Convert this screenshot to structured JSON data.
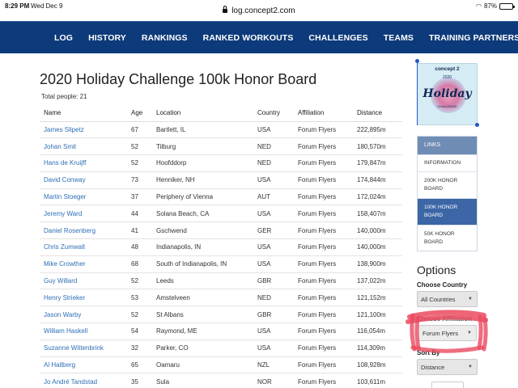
{
  "status_bar": {
    "time": "8:29 PM",
    "date": "Wed Dec 9",
    "battery": "87%",
    "battery_level": 0.87
  },
  "browser": {
    "url": "log.concept2.com"
  },
  "nav": [
    "LOG",
    "HISTORY",
    "RANKINGS",
    "RANKED WORKOUTS",
    "CHALLENGES",
    "TEAMS",
    "TRAINING PARTNERS"
  ],
  "page": {
    "title": "2020 Holiday Challenge 100k Honor Board",
    "total": "Total people: 21"
  },
  "table": {
    "headers": [
      "Name",
      "Age",
      "Location",
      "Country",
      "Affiliation",
      "Distance"
    ],
    "rows": [
      [
        "James Slipetz",
        "67",
        "Bartlett, IL",
        "USA",
        "Forum Flyers",
        "222,895m"
      ],
      [
        "Johan Smit",
        "52",
        "Tilburg",
        "NED",
        "Forum Flyers",
        "180,570m"
      ],
      [
        "Hans de Kruijff",
        "52",
        "Hoofddorp",
        "NED",
        "Forum Flyers",
        "179,847m"
      ],
      [
        "David Conway",
        "73",
        "Henniker, NH",
        "USA",
        "Forum Flyers",
        "174,844m"
      ],
      [
        "Martin Stoeger",
        "37",
        "Periphery of Vienna",
        "AUT",
        "Forum Flyers",
        "172,024m"
      ],
      [
        "Jeremy Ward",
        "44",
        "Solana Beach, CA",
        "USA",
        "Forum Flyers",
        "158,407m"
      ],
      [
        "Daniel Rosenberg",
        "41",
        "Gschwend",
        "GER",
        "Forum Flyers",
        "140,000m"
      ],
      [
        "Chris Zumwalt",
        "48",
        "Indianapolis, IN",
        "USA",
        "Forum Flyers",
        "140,000m"
      ],
      [
        "Mike Crowther",
        "68",
        "South of Indianapolis, IN",
        "USA",
        "Forum Flyers",
        "138,900m"
      ],
      [
        "Guy Willard",
        "52",
        "Leeds",
        "GBR",
        "Forum Flyers",
        "137,022m"
      ],
      [
        "Henry Strieker",
        "53",
        "Amstelveen",
        "NED",
        "Forum Flyers",
        "121,152m"
      ],
      [
        "Jason Warby",
        "52",
        "St Albans",
        "GBR",
        "Forum Flyers",
        "121,100m"
      ],
      [
        "William Haskell",
        "54",
        "Raymond, ME",
        "USA",
        "Forum Flyers",
        "116,054m"
      ],
      [
        "Suzanne Wittenbrink",
        "32",
        "Parker, CO",
        "USA",
        "Forum Flyers",
        "114,309m"
      ],
      [
        "Al Hallberg",
        "65",
        "Oamaru",
        "NZL",
        "Forum Flyers",
        "108,928m"
      ],
      [
        "Jo André Tandstad",
        "35",
        "Sula",
        "NOR",
        "Forum Flyers",
        "103,611m"
      ]
    ]
  },
  "logo": {
    "brand": "concept 2",
    "year": "2020",
    "word": "Holiday",
    "sub": "CHALLENGE"
  },
  "links": {
    "header": "LINKS",
    "items": [
      {
        "label": "INFORMATION",
        "active": false
      },
      {
        "label": "200K HONOR BOARD",
        "active": false
      },
      {
        "label": "100K HONOR BOARD",
        "active": true
      },
      {
        "label": "50K HONOR BOARD",
        "active": false
      }
    ]
  },
  "options": {
    "title": "Options",
    "country_label": "Choose Country",
    "country_value": "All Countries",
    "affiliation_label": "Choose Affiliation",
    "affiliation_value": "Forum Flyers",
    "sort_label": "Sort By",
    "sort_value": "Distance"
  },
  "colors": {
    "nav_bg": "#0d3a7a",
    "link": "#2f6fb5",
    "active_link_bg": "#3c66a6",
    "annotation": "#ea4a5f"
  }
}
